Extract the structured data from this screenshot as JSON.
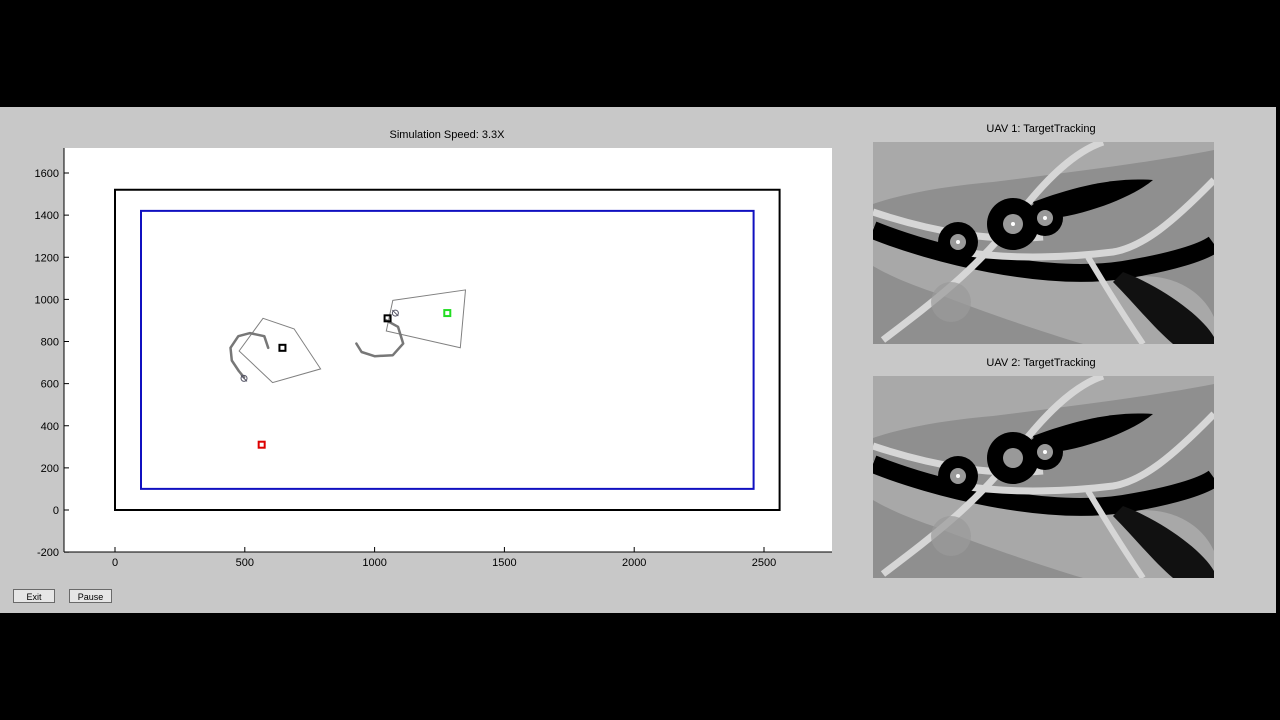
{
  "window": {
    "background_color": "#c8c8c8"
  },
  "main_plot": {
    "title": "Simulation Speed: 3.3X",
    "x_ticks": [
      "0",
      "500",
      "1000",
      "1500",
      "2000",
      "2500"
    ],
    "y_ticks": [
      "1600",
      "1400",
      "1200",
      "1000",
      "800",
      "600",
      "400",
      "200",
      "0",
      "-200"
    ]
  },
  "camera_views": [
    {
      "title": "UAV 1: TargetTracking"
    },
    {
      "title": "UAV 2: TargetTracking"
    }
  ],
  "buttons": {
    "exit_label": "Exit",
    "pause_label": "Pause"
  },
  "chart_data": {
    "type": "scatter",
    "xlim": [
      -200,
      2750
    ],
    "ylim": [
      -200,
      1720
    ],
    "grid": false,
    "outer_boundary": [
      [
        0,
        0
      ],
      [
        2560,
        0
      ],
      [
        2560,
        1520
      ],
      [
        0,
        1520
      ]
    ],
    "search_area": [
      [
        100,
        100
      ],
      [
        2460,
        100
      ],
      [
        2460,
        1420
      ],
      [
        100,
        1420
      ]
    ],
    "targets": [
      {
        "x": 645,
        "y": 770,
        "color": "#000000"
      },
      {
        "x": 1050,
        "y": 910,
        "color": "#000000"
      },
      {
        "x": 1280,
        "y": 935,
        "color": "#22dd22"
      },
      {
        "x": 565,
        "y": 310,
        "color": "#dd0000"
      }
    ],
    "sensor_footprints": [
      [
        [
          478,
          755
        ],
        [
          570,
          910
        ],
        [
          690,
          860
        ],
        [
          792,
          670
        ],
        [
          607,
          605
        ]
      ],
      [
        [
          1070,
          995
        ],
        [
          1350,
          1045
        ],
        [
          1330,
          770
        ],
        [
          1045,
          850
        ]
      ]
    ],
    "uav_trails": [
      [
        [
          590,
          770
        ],
        [
          575,
          825
        ],
        [
          520,
          840
        ],
        [
          475,
          825
        ],
        [
          445,
          770
        ],
        [
          450,
          710
        ],
        [
          477,
          660
        ],
        [
          497,
          630
        ]
      ],
      [
        [
          1045,
          900
        ],
        [
          1090,
          870
        ],
        [
          1110,
          790
        ],
        [
          1070,
          735
        ],
        [
          1000,
          730
        ],
        [
          950,
          750
        ],
        [
          930,
          790
        ]
      ]
    ],
    "uav_positions": [
      {
        "x": 497,
        "y": 625
      },
      {
        "x": 1080,
        "y": 935
      }
    ]
  }
}
